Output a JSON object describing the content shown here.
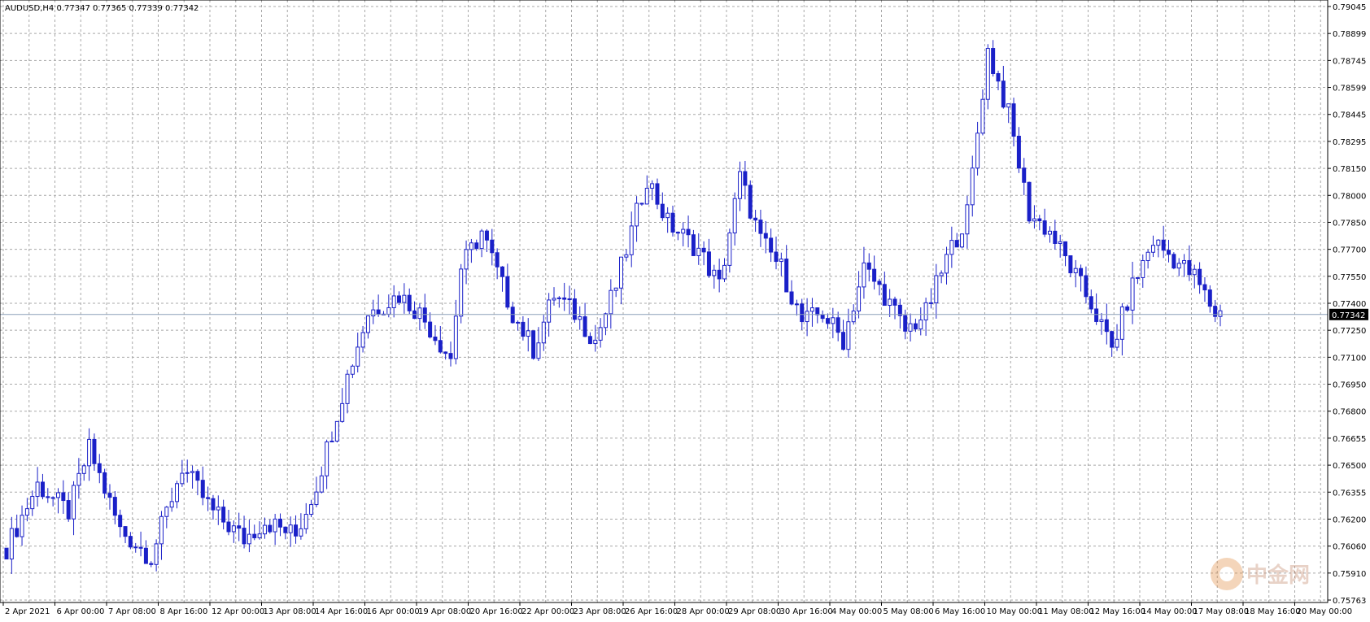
{
  "chart_data": {
    "type": "candlestick",
    "symbol_header": "AUDUSD,H4  0.77347 0.77365 0.77339 0.77342",
    "current_price": 0.77342,
    "current_price_label": "0.77342",
    "ylim": [
      0.75763,
      0.79045
    ],
    "y_tick_labels": [
      "0.79045",
      "0.78899",
      "0.78745",
      "0.78599",
      "0.78445",
      "0.78295",
      "0.78150",
      "0.78000",
      "0.77850",
      "0.77700",
      "0.77550",
      "0.77400",
      "0.77250",
      "0.77100",
      "0.76950",
      "0.76800",
      "0.76655",
      "0.76500",
      "0.76355",
      "0.76200",
      "0.76060",
      "0.75910",
      "0.75763"
    ],
    "x_tick_labels": [
      "2 Apr 2021",
      "6 Apr 00:00",
      "7 Apr 08:00",
      "8 Apr 16:00",
      "12 Apr 00:00",
      "13 Apr 08:00",
      "14 Apr 16:00",
      "16 Apr 00:00",
      "19 Apr 08:00",
      "20 Apr 16:00",
      "22 Apr 00:00",
      "23 Apr 08:00",
      "26 Apr 16:00",
      "28 Apr 00:00",
      "29 Apr 08:00",
      "30 Apr 16:00",
      "4 May 00:00",
      "5 May 08:00",
      "6 May 16:00",
      "10 May 00:00",
      "11 May 08:00",
      "12 May 16:00",
      "14 May 00:00",
      "17 May 08:00",
      "18 May 16:00",
      "20 May 00:00"
    ],
    "grid": true,
    "bull_color": "#ffffff",
    "bear_color": "#1a20c8",
    "wick_color": "#1a20c8",
    "price_line_color": "#8ca0b8",
    "grid_color": "#a8a8a8",
    "watermark": "中金网"
  }
}
